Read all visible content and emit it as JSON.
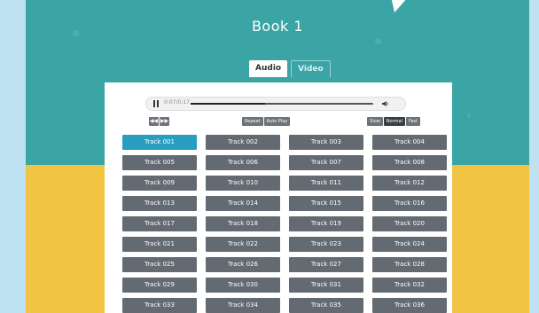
{
  "book": {
    "title": "Book 1"
  },
  "tabs": [
    {
      "label": "Audio",
      "active": true
    },
    {
      "label": "Video",
      "active": false
    }
  ],
  "player": {
    "time": "0:07/0:17",
    "progress": 0.41,
    "state": "playing"
  },
  "controls": {
    "prev_glyph": "◀◀",
    "next_glyph": "▶▶",
    "repeat_label": "Repeat",
    "autoplay_label": "Auto Play",
    "speeds": [
      {
        "label": "Slow",
        "selected": false
      },
      {
        "label": "Normal",
        "selected": true
      },
      {
        "label": "Fast",
        "selected": false
      }
    ]
  },
  "tracks": [
    "Track 001",
    "Track 002",
    "Track 003",
    "Track 004",
    "Track 005",
    "Track 006",
    "Track 007",
    "Track 008",
    "Track 009",
    "Track 010",
    "Track 011",
    "Track 012",
    "Track 013",
    "Track 014",
    "Track 015",
    "Track 016",
    "Track 017",
    "Track 018",
    "Track 019",
    "Track 020",
    "Track 021",
    "Track 022",
    "Track 023",
    "Track 024",
    "Track 025",
    "Track 026",
    "Track 027",
    "Track 028",
    "Track 029",
    "Track 030",
    "Track 031",
    "Track 032",
    "Track 033",
    "Track 034",
    "Track 035",
    "Track 036"
  ],
  "active_track_index": 0,
  "colors": {
    "teal_background": "#3aa5a4",
    "yellow_background": "#f2c444",
    "outer_background": "#bfe2f3",
    "track_button": "#636a71",
    "track_button_active": "#2a9ec1"
  },
  "icons": {
    "pause": "pause-icon",
    "volume": "volume-icon"
  }
}
